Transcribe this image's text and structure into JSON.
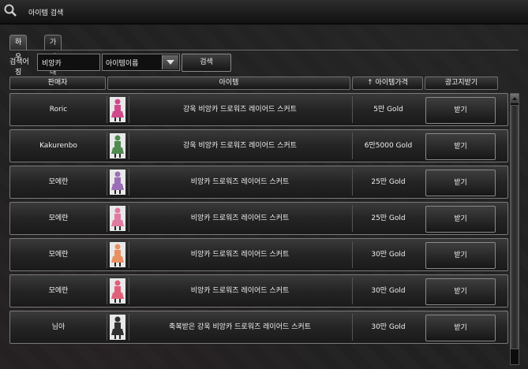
{
  "window": {
    "title": "아이템 검색",
    "icon": "magnifier-icon"
  },
  "tabs": [
    {
      "label": "하우징",
      "active": true
    },
    {
      "label": "가판대",
      "active": false
    }
  ],
  "search": {
    "label": "검색어",
    "value": "비앙카",
    "select_value": "아이템이름",
    "button_label": "검색"
  },
  "columns": {
    "seller": "판매자",
    "item": "아이템",
    "price": "↑ 아이템가격",
    "receive": "광고지받기"
  },
  "rows": [
    {
      "seller": "Roric",
      "item": "강욱 비앙카 드로워즈 레이어드 스커트",
      "price": "5만 Gold",
      "button": "받기",
      "thumb_color": "#d04a8a"
    },
    {
      "seller": "Kakurenbo",
      "item": "강욱 비앙카 드로워즈 레이어드 스커트",
      "price": "6만5000 Gold",
      "button": "받기",
      "thumb_color": "#4f8a4f"
    },
    {
      "seller": "모에란",
      "item": "비앙카 드로워즈 레이어드 스커트",
      "price": "25만 Gold",
      "button": "받기",
      "thumb_color": "#9a6fb6"
    },
    {
      "seller": "모에란",
      "item": "비앙카 드로워즈 레이어드 스커트",
      "price": "25만 Gold",
      "button": "받기",
      "thumb_color": "#e07aa0"
    },
    {
      "seller": "모에란",
      "item": "비앙카 드로워즈 레이어드 스커트",
      "price": "30만 Gold",
      "button": "받기",
      "thumb_color": "#e89060"
    },
    {
      "seller": "모에란",
      "item": "비앙카 드로워즈 레이어드 스커트",
      "price": "30만 Gold",
      "button": "받기",
      "thumb_color": "#e0607a"
    },
    {
      "seller": "님아",
      "item": "축복받은 강욱 비앙카 드로워즈 레이어드 스커트",
      "price": "30만 Gold",
      "button": "받기",
      "thumb_color": "#303030"
    }
  ]
}
